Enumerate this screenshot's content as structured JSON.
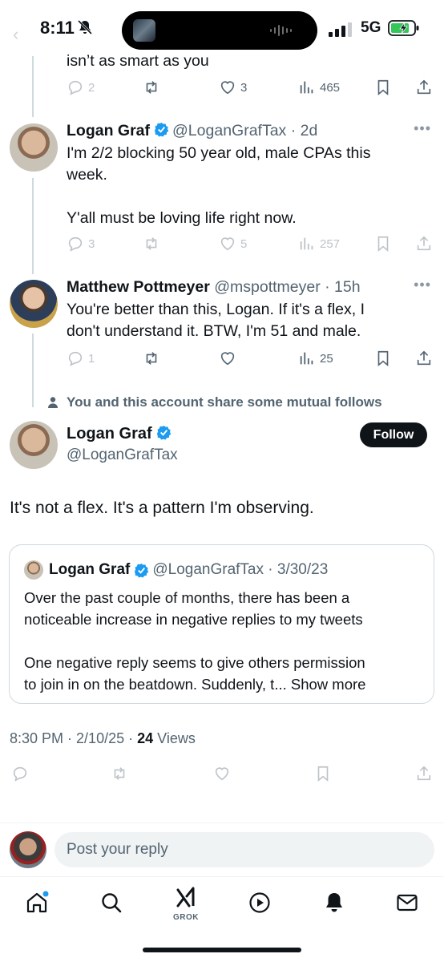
{
  "status_bar": {
    "time": "8:11",
    "network": "5G"
  },
  "thread": [
    {
      "text_tail": "isn’t as smart as you",
      "actions": {
        "replies": "2",
        "likes": "3",
        "views": "465"
      }
    },
    {
      "name": "Logan Graf",
      "handle": "@LoganGrafTax",
      "time": "· 2d",
      "lines": [
        "I'm 2/2 blocking 50 year old, male CPAs this",
        "week.",
        "Y'all must be loving life right now."
      ],
      "actions": {
        "replies": "3",
        "likes": "5",
        "views": "257"
      }
    },
    {
      "name": "Matthew Pottmeyer",
      "handle": "@mspottmeyer",
      "time": "· 15h",
      "lines": [
        "You're better than this, Logan.  If it's a flex, I",
        "don't understand it.  BTW, I'm 51 and male."
      ],
      "actions": {
        "replies": "1",
        "likes": "",
        "views": "25"
      }
    }
  ],
  "mutual_notice": "You and this account share some mutual follows",
  "main_tweet": {
    "name": "Logan Graf",
    "handle": "@LoganGrafTax",
    "follow_label": "Follow",
    "text": "It's not a flex. It's a pattern I'm observing.",
    "quote": {
      "name": "Logan Graf",
      "handle": "@LoganGrafTax",
      "date": "· 3/30/23",
      "lines": [
        "Over the past couple of months, there has been a",
        "noticeable increase in negative replies to my tweets",
        "One negative reply seems to give others permission",
        "to join in on the beatdown. Suddenly, t..."
      ],
      "show_more": "Show more"
    },
    "time": "8:30 PM",
    "date": "2/10/25",
    "views_count": "24",
    "views_label": "Views"
  },
  "reply_placeholder": "Post your reply",
  "tabs": [
    "home-icon",
    "search-icon",
    "grok-icon",
    "video-icon",
    "notifications-icon",
    "messages-icon"
  ],
  "grok_label": "GROK",
  "colors": {
    "text": "#0f1419",
    "secondary": "#536471",
    "verified": "#1d9bf0",
    "notification_dot": "#1d9bf0"
  }
}
